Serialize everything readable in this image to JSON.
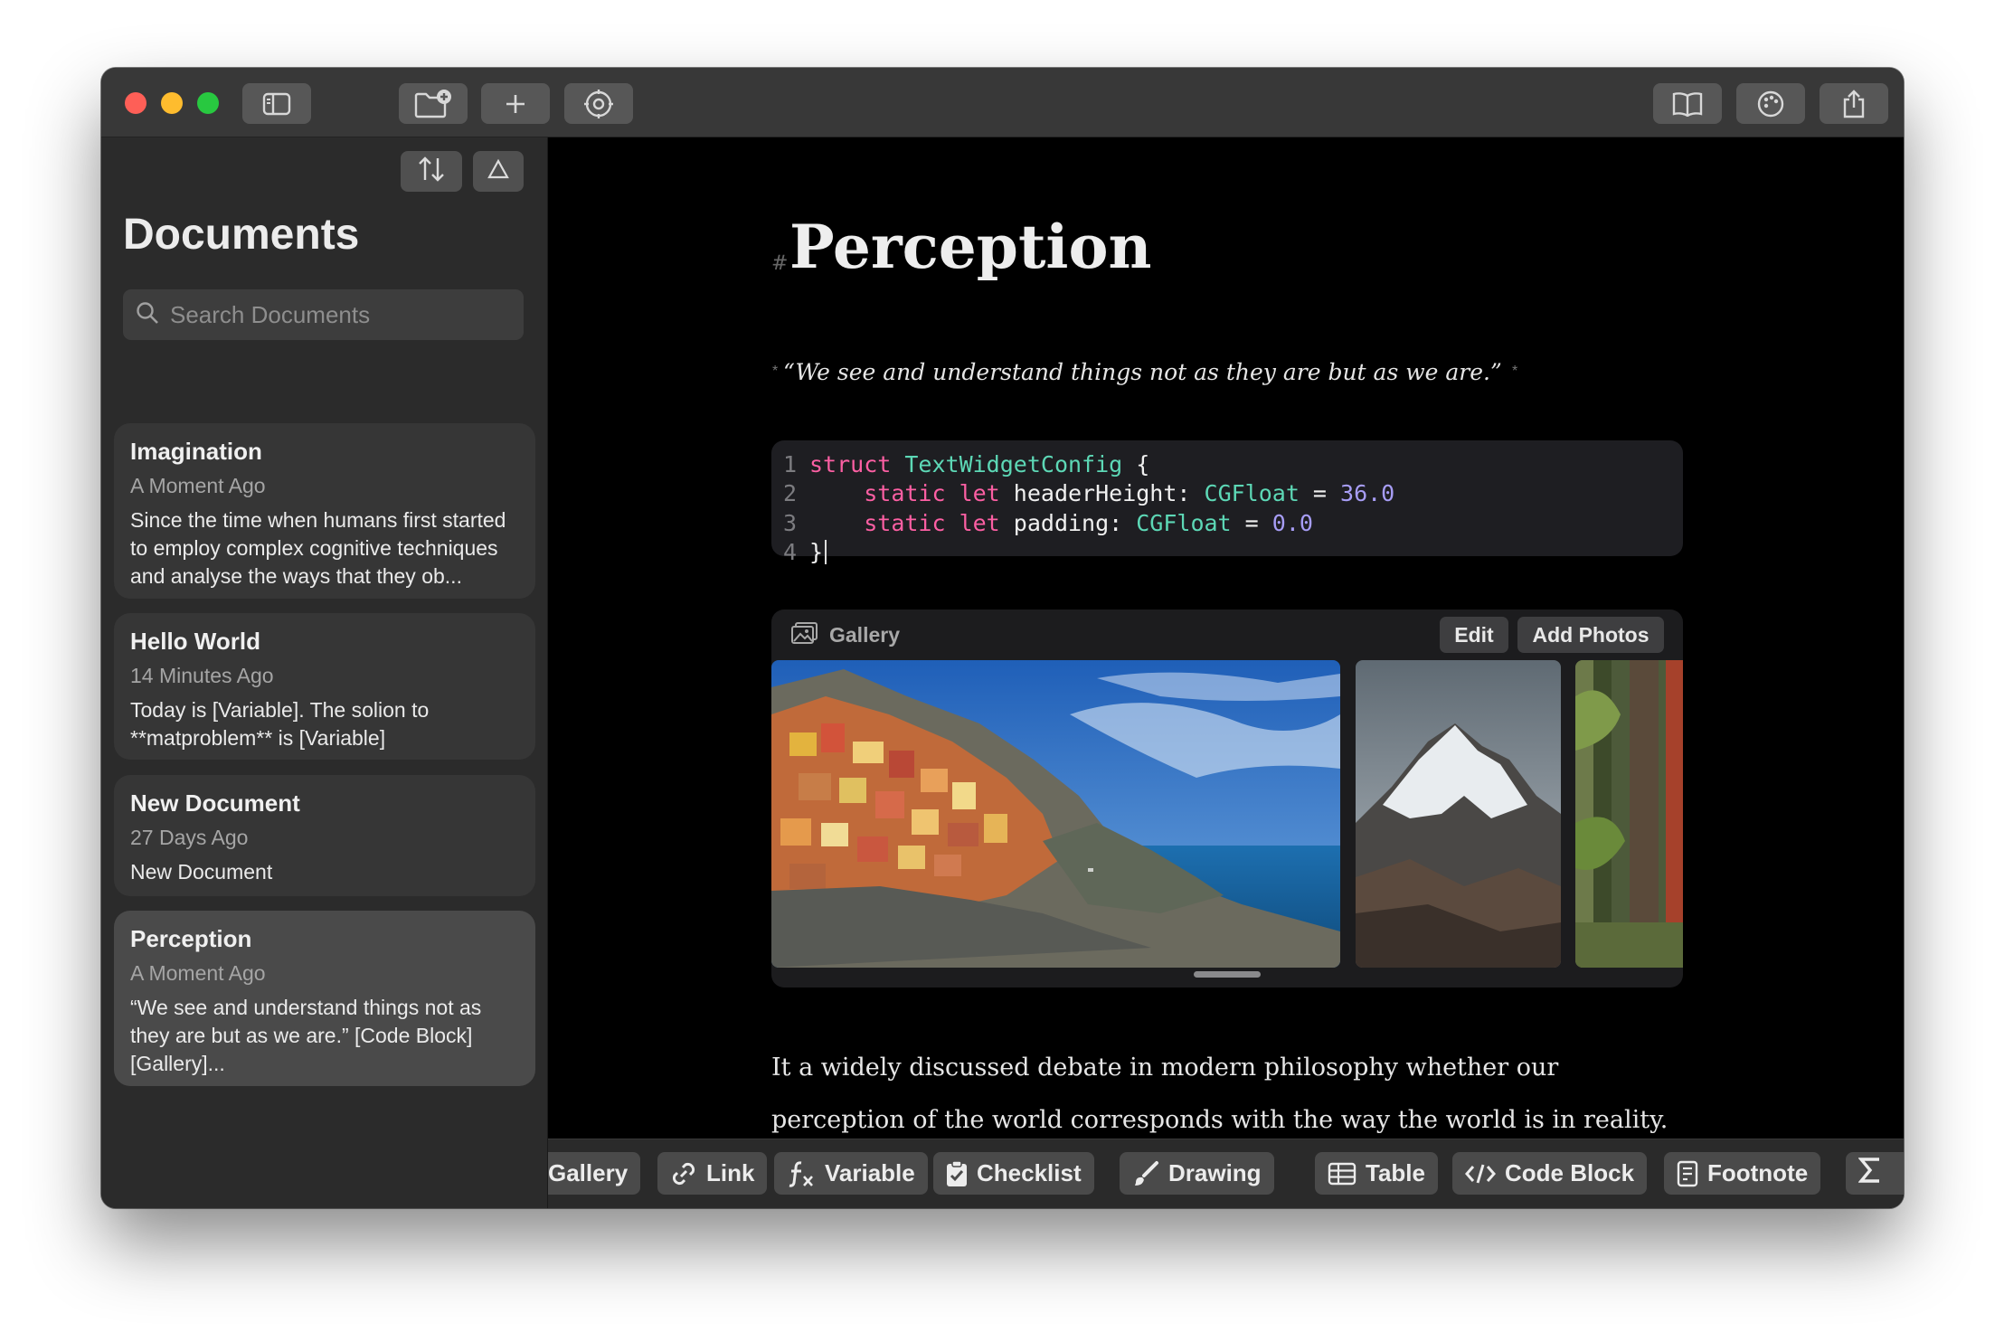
{
  "sidebar": {
    "title": "Documents",
    "search_placeholder": "Search Documents",
    "documents": [
      {
        "title": "Imagination",
        "time": "A Moment Ago",
        "preview": "Since the time when humans first started to employ complex cognitive techniques and analyse the ways that they ob..."
      },
      {
        "title": "Hello World",
        "time": "14 Minutes Ago",
        "preview": "Today is [Variable]. The solion to **matproblem** is [Variable]"
      },
      {
        "title": "New Document",
        "time": "27 Days Ago",
        "preview": "New Document"
      },
      {
        "title": "Perception",
        "time": "A Moment Ago",
        "preview": "“We see and understand things not as they are but as we are.” [Code Block] [Gallery]..."
      }
    ]
  },
  "editor": {
    "heading_marker": "#",
    "heading": "Perception",
    "quote_marker": "*",
    "quote": "“We see and understand things not as they are but as we are.”",
    "code": {
      "line_numbers": [
        "1",
        "2",
        "3",
        "4"
      ],
      "line1": {
        "kw": "struct",
        "name": "TextWidgetConfig",
        "rest": " {"
      },
      "line2": {
        "kw": "static let",
        "name": " headerHeight: ",
        "type": "CGFloat",
        "eq": " = ",
        "num": "36.0"
      },
      "line3": {
        "kw": "static let",
        "name": " padding: ",
        "type": "CGFloat",
        "eq": " = ",
        "num": "0.0"
      },
      "line4": {
        "text": "}"
      }
    },
    "gallery": {
      "label": "Gallery",
      "edit_label": "Edit",
      "add_label": "Add Photos",
      "photos": [
        "coastal-village-photo",
        "snowy-mountain-photo",
        "forest-trees-photo"
      ]
    },
    "body": "It a widely discussed debate in modern philosophy whether our perception of the world corresponds with the way the world is in reality. In many cases they way we look at the nature that surrounds us is greatly affected by various emotions,"
  },
  "toolbar": {
    "items": [
      "Gallery",
      "Link",
      "Variable",
      "Checklist",
      "Drawing",
      "Table",
      "Code Block",
      "Footnote"
    ]
  },
  "colors": {
    "keyword": "#fc5fa3",
    "type": "#5dd8b6",
    "number": "#a79df5",
    "close": "#fe5f57",
    "minimize": "#febc2e",
    "zoom": "#28c840"
  }
}
